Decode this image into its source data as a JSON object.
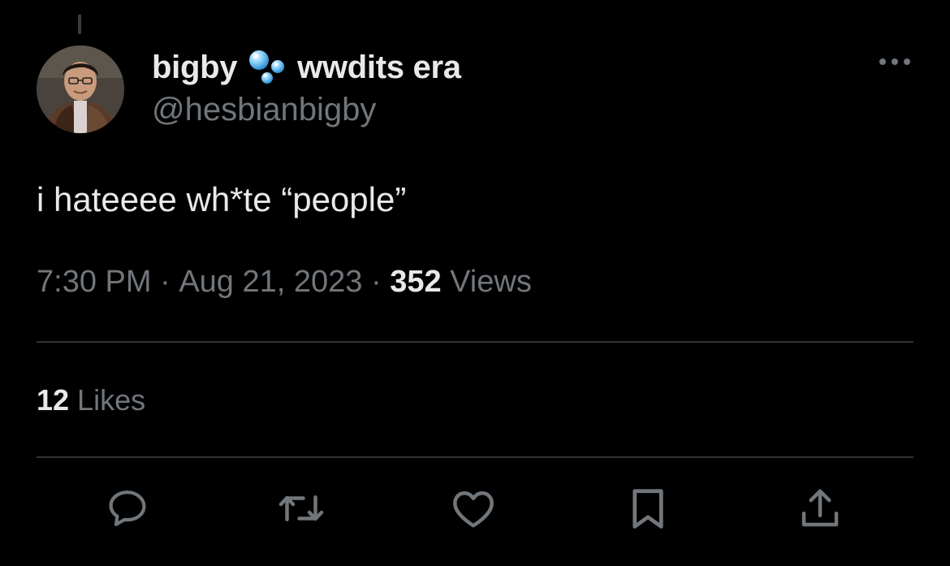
{
  "tweet": {
    "display_name": "bigby",
    "name_emoji": "bubbles-emoji",
    "name_suffix": "wwdits era",
    "handle": "@hesbianbigby",
    "text": "i hateeee wh*te “people”",
    "time": "7:30 PM",
    "separator": " · ",
    "date": "Aug 21, 2023",
    "views_count": "352",
    "views_label": " Views",
    "likes_count": "12",
    "likes_label": " Likes"
  },
  "icons": {
    "more": "more-dots-icon",
    "reply": "reply-icon",
    "retweet": "retweet-icon",
    "like": "heart-icon",
    "bookmark": "bookmark-icon",
    "share": "share-icon"
  },
  "colors": {
    "background": "#000000",
    "text_primary": "#e7e9ea",
    "text_secondary": "#71767b",
    "divider": "#2f3336",
    "bubble": "#4fb3f2"
  }
}
